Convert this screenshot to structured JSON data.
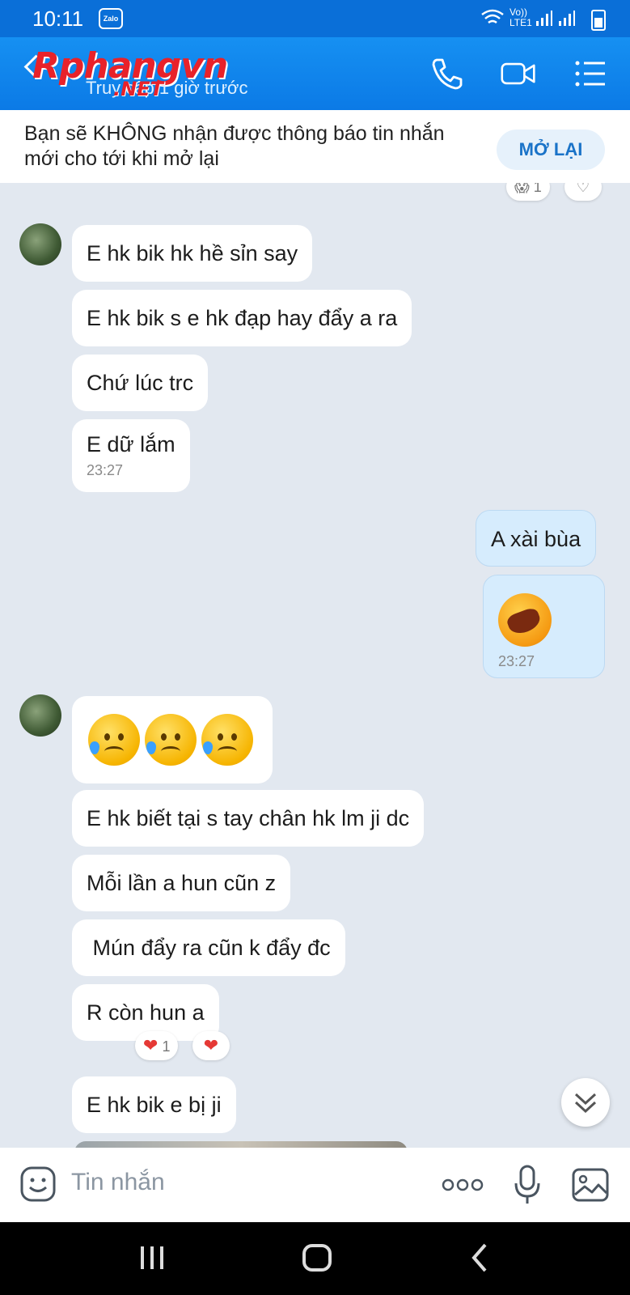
{
  "status_bar": {
    "time": "10:11",
    "app_badge": "Zalo",
    "net_label_1": "Vo))",
    "net_label_2": "LTE1"
  },
  "header": {
    "logo_main": "Rphangvn",
    "logo_suffix": ".NET",
    "subtitle": "Truy cập 1 giờ trước"
  },
  "banner": {
    "message": "Bạn sẽ KHÔNG nhận được thông báo tin nhắn mới cho tới khi mở lại",
    "button_label": "MỞ LẠI"
  },
  "top_reaction": {
    "count": "1"
  },
  "messages": {
    "m1": "E hk bik hk hề sỉn say",
    "m2": "E hk bik s e hk đạp hay đẩy a ra",
    "m3": "Chứ lúc trc",
    "m4": "E dữ lắm",
    "m4_time": "23:27",
    "m5": "A xài bùa",
    "m6_time": "23:27",
    "m8": "E hk biết tại s tay chân hk lm ji dc",
    "m9": "Mỗi lần a hun cũn z",
    "m10": " Mún đẩy ra cũn k đẩy đc",
    "m11": "R còn hun a",
    "m11_react_count": "1",
    "m12": "E hk bik e bị ji"
  },
  "input": {
    "placeholder": "Tin nhắn"
  },
  "colors": {
    "header": "#0b7ae6",
    "chat_bg": "#e2e8f0",
    "my_bubble": "#d6ecfd",
    "accent": "#1a73c8"
  }
}
